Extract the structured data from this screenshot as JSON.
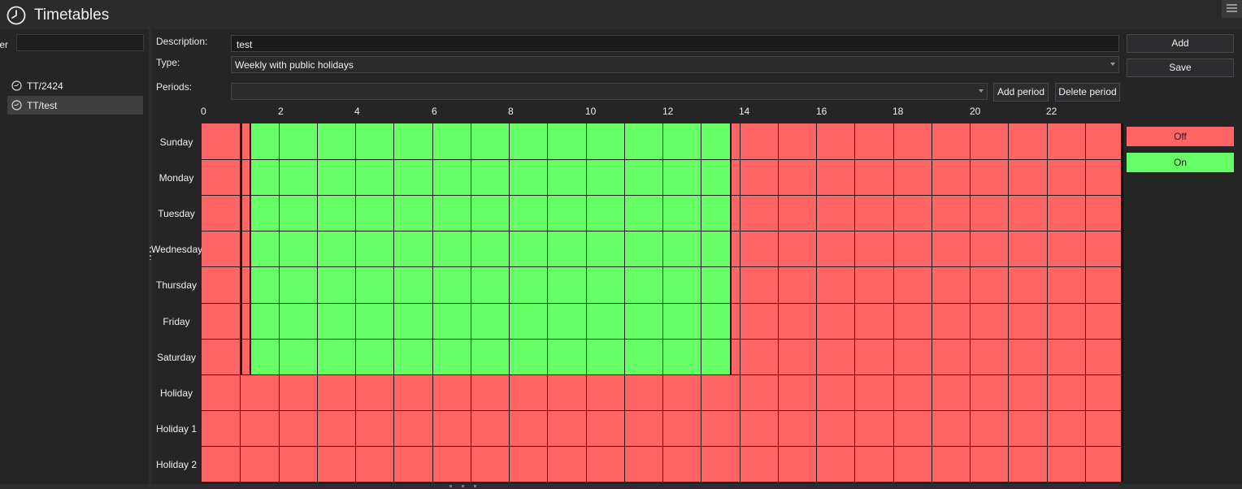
{
  "app": {
    "title": "Timetables",
    "icon": "clock-icon"
  },
  "sidebar": {
    "filter_label": "ter",
    "filter_value": "",
    "items": [
      {
        "label": "TT/2424",
        "icon": "clock-icon",
        "selected": false
      },
      {
        "label": "TT/test",
        "icon": "clock-icon",
        "selected": true
      }
    ]
  },
  "form": {
    "description_label": "Description:",
    "description_value": "test",
    "type_label": "Type:",
    "type_value": "Weekly with public holidays",
    "periods_label": "Periods:",
    "periods_value": ""
  },
  "buttons": {
    "add": "Add",
    "save": "Save",
    "add_period": "Add period",
    "delete_period": "Delete period"
  },
  "grid": {
    "hour_labels": [
      "0",
      "2",
      "4",
      "6",
      "8",
      "10",
      "12",
      "14",
      "16",
      "18",
      "20",
      "22"
    ],
    "rows": [
      "Sunday",
      "Monday",
      "Tuesday",
      "Wednesday",
      "Thursday",
      "Friday",
      "Saturday",
      "Holiday",
      "Holiday 1",
      "Holiday 2"
    ],
    "on_period": {
      "days": [
        "Sunday",
        "Monday",
        "Tuesday",
        "Wednesday",
        "Thursday",
        "Friday",
        "Saturday"
      ],
      "start": "01:15",
      "end": "13:45"
    }
  },
  "legend": {
    "off": {
      "label": "Off",
      "color": "#ff6565"
    },
    "on": {
      "label": "On",
      "color": "#66ff66"
    }
  }
}
